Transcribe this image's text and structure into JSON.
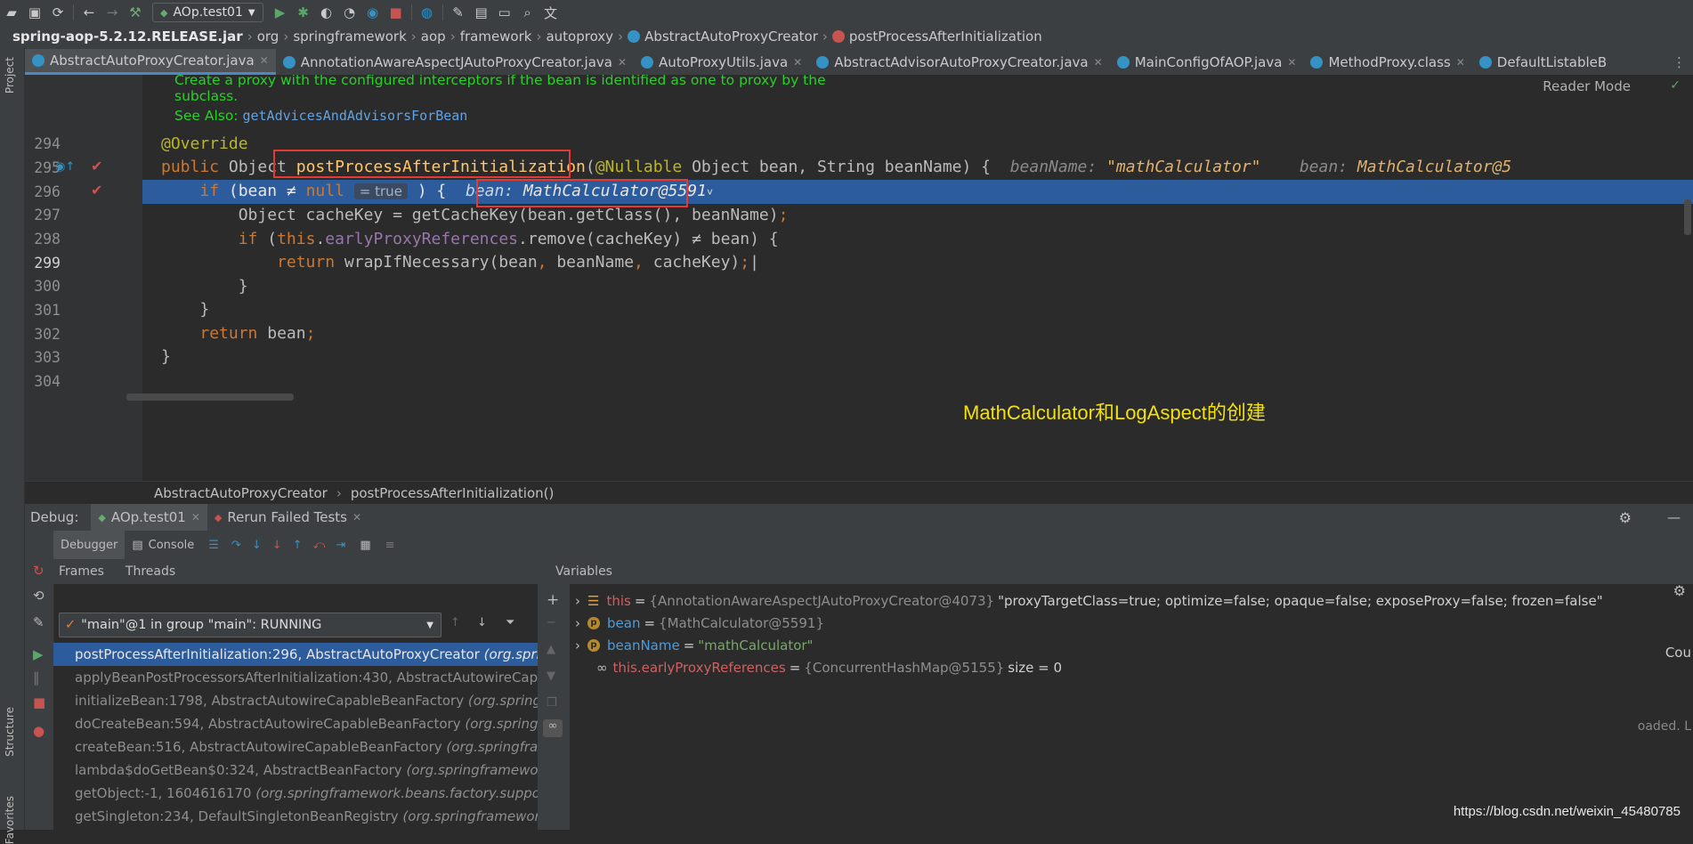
{
  "toolbar": {
    "run_config": "AOp.test01"
  },
  "breadcrumb": {
    "items": [
      "spring-aop-5.2.12.RELEASE.jar",
      "org",
      "springframework",
      "aop",
      "framework",
      "autoproxy",
      "AbstractAutoProxyCreator",
      "postProcessAfterInitialization"
    ]
  },
  "tabs": [
    {
      "label": "AbstractAutoProxyCreator.java"
    },
    {
      "label": "AnnotationAwareAspectJAutoProxyCreator.java"
    },
    {
      "label": "AutoProxyUtils.java"
    },
    {
      "label": "AbstractAdvisorAutoProxyCreator.java"
    },
    {
      "label": "MainConfigOfAOP.java"
    },
    {
      "label": "MethodProxy.class"
    },
    {
      "label": "DefaultListableB"
    }
  ],
  "side": {
    "project": "Project",
    "structure": "Structure",
    "favorites": "Favorites"
  },
  "editor": {
    "reader_mode": "Reader Mode",
    "doc_line1": "Create a proxy with the configured interceptors if the bean is identified as one to proxy by the",
    "doc_line2": "subclass.",
    "doc_see_also": "See Also:",
    "doc_link": "getAdvicesAndAdvisorsForBean",
    "lines": [
      "294",
      "295",
      "296",
      "297",
      "298",
      "299",
      "300",
      "301",
      "302",
      "303",
      "304"
    ],
    "hint_beanname_label": "beanName:",
    "hint_beanname_value": "\"mathCalculator\"",
    "hint_bean_label": "bean:",
    "hint_bean_value": "MathCalculator@5",
    "inlay_true": "= true",
    "line296_hint_label": "bean:",
    "line296_hint_value": "MathCalculator@5591"
  },
  "annotation_text": "MathCalculator和LogAspect的创建",
  "navbar": {
    "class": "AbstractAutoProxyCreator",
    "method": "postProcessAfterInitialization()"
  },
  "debug": {
    "label": "Debug:",
    "tab1": "AOp.test01",
    "tab2": "Rerun Failed Tests",
    "debugger": "Debugger",
    "console": "Console",
    "frames": "Frames",
    "threads": "Threads",
    "variables": "Variables",
    "thread_text": "\"main\"@1 in group \"main\": RUNNING",
    "frame_list": [
      {
        "main": "postProcessAfterInitialization:296, AbstractAutoProxyCreator ",
        "pkg": "(org.sprin"
      },
      {
        "main": "applyBeanPostProcessorsAfterInitialization:430, AbstractAutowireCapabl",
        "pkg": ""
      },
      {
        "main": "initializeBean:1798, AbstractAutowireCapableBeanFactory ",
        "pkg": "(org.springfra"
      },
      {
        "main": "doCreateBean:594, AbstractAutowireCapableBeanFactory ",
        "pkg": "(org.springfra"
      },
      {
        "main": "createBean:516, AbstractAutowireCapableBeanFactory ",
        "pkg": "(org.springframe"
      },
      {
        "main": "lambda$doGetBean$0:324, AbstractBeanFactory ",
        "pkg": "(org.springframework."
      },
      {
        "main": "getObject:-1, 1604616170 ",
        "pkg": "(org.springframework.beans.factory.support."
      },
      {
        "main": "getSingleton:234, DefaultSingletonBeanRegistry ",
        "pkg": "(org.springframework.b"
      }
    ],
    "vars": {
      "this_name": "this",
      "this_value": "{AnnotationAwareAspectJAutoProxyCreator@4073}",
      "this_extra": "\"proxyTargetClass=true; optimize=false; opaque=false; exposeProxy=false; frozen=false\"",
      "bean_name": "bean",
      "bean_value": "{MathCalculator@5591}",
      "beanname_name": "beanName",
      "beanname_value": "\"mathCalculator\"",
      "epr_name": "this.earlyProxyReferences",
      "epr_value": "{ConcurrentHashMap@5155}",
      "epr_size": "size = 0"
    },
    "right_cut_1": "Cou",
    "right_cut_2": "oaded. L"
  },
  "watermark": "https://blog.csdn.net/weixin_45480785",
  "colors": {
    "accent_blue": "#2d5c9c",
    "annotation_yellow": "#f2e012",
    "highlight_red": "#e53935"
  }
}
